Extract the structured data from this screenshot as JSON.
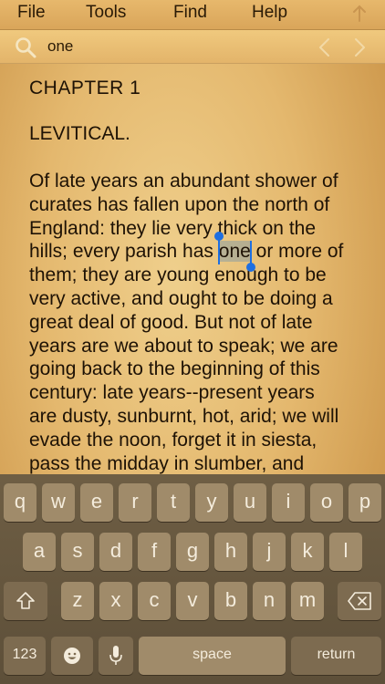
{
  "menu": {
    "file": "File",
    "tools": "Tools",
    "find": "Find",
    "help": "Help"
  },
  "search": {
    "value": "one"
  },
  "book": {
    "chapter": "CHAPTER  1",
    "section": "LEVITICAL.",
    "lines": [
      "Of late years an abundant shower of",
      "curates has fallen upon the north of",
      "England: they lie very thick on the",
      "hills; every parish has ",
      "them; they are young enough to be",
      "very active, and ought to be doing a",
      "great deal of good. But not of late",
      "years are we about to speak; we are",
      "going back to the beginning of this",
      "century: late years--present years",
      "are dusty, sunburnt, hot, arid; we will",
      "evade the noon, forget it in siesta,",
      "pass the midday in slumber, and"
    ],
    "highlight": "one",
    "line4_after": " or more of"
  },
  "keyboard": {
    "row1": [
      "q",
      "w",
      "e",
      "r",
      "t",
      "y",
      "u",
      "i",
      "o",
      "p"
    ],
    "row2": [
      "a",
      "s",
      "d",
      "f",
      "g",
      "h",
      "j",
      "k",
      "l"
    ],
    "row3": [
      "z",
      "x",
      "c",
      "v",
      "b",
      "n",
      "m"
    ],
    "numbers": "123",
    "space": "space",
    "return": "return"
  },
  "colors": {
    "selection_handle": "#1f6fe0",
    "keyboard_bg": "#5d4f39",
    "key_bg": "#a08b6a"
  }
}
